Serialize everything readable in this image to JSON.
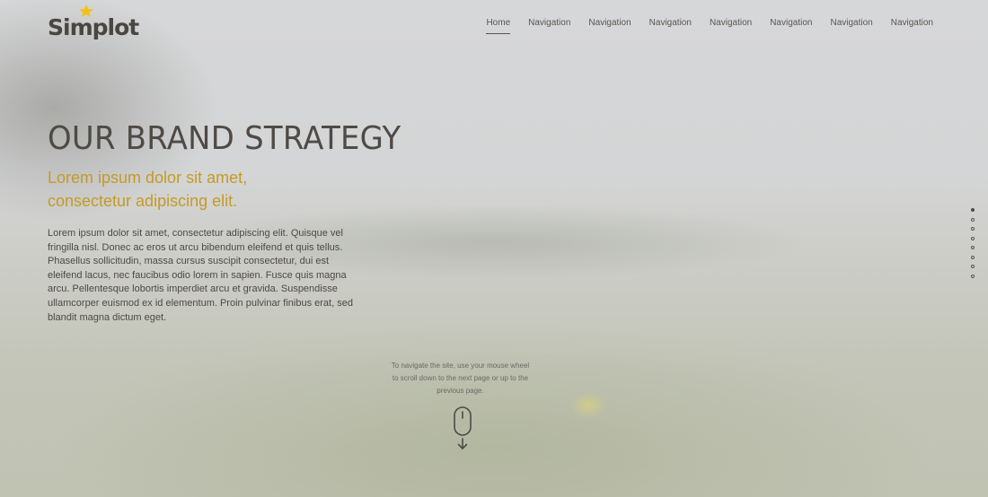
{
  "brand": {
    "name": "Simplot",
    "star_color": "#f2c21a",
    "text_color": "#4a4642"
  },
  "nav": {
    "items": [
      {
        "label": "Home",
        "active": true
      },
      {
        "label": "Navigation",
        "active": false
      },
      {
        "label": "Navigation",
        "active": false
      },
      {
        "label": "Navigation",
        "active": false
      },
      {
        "label": "Navigation",
        "active": false
      },
      {
        "label": "Navigation",
        "active": false
      },
      {
        "label": "Navigation",
        "active": false
      },
      {
        "label": "Navigation",
        "active": false
      }
    ]
  },
  "hero": {
    "title": "OUR BRAND STRATEGY",
    "subtitle_line1": "Lorem ipsum dolor sit amet,",
    "subtitle_line2": "consectetur adipiscing elit.",
    "body": "Lorem ipsum dolor sit amet, consectetur adipiscing elit. Quisque vel fringilla nisl. Donec ac eros ut arcu bibendum eleifend et quis tellus. Phasellus sollicitudin, massa cursus suscipit consectetur, dui est eleifend lacus, nec faucibus odio lorem in sapien. Fusce quis magna arcu. Pellentesque lobortis imperdiet arcu et gravida. Suspendisse ullamcorper euismod ex id elementum. Proin pulvinar finibus erat, sed blandit magna dictum eget.",
    "accent_color": "#c49b26"
  },
  "scroll_hint": {
    "text": "To navigate the site, use your mouse wheel to scroll down to the next page or up to the previous page.",
    "icon": "mouse-scroll-icon"
  },
  "page_dots": {
    "count": 8,
    "active_index": 0
  }
}
